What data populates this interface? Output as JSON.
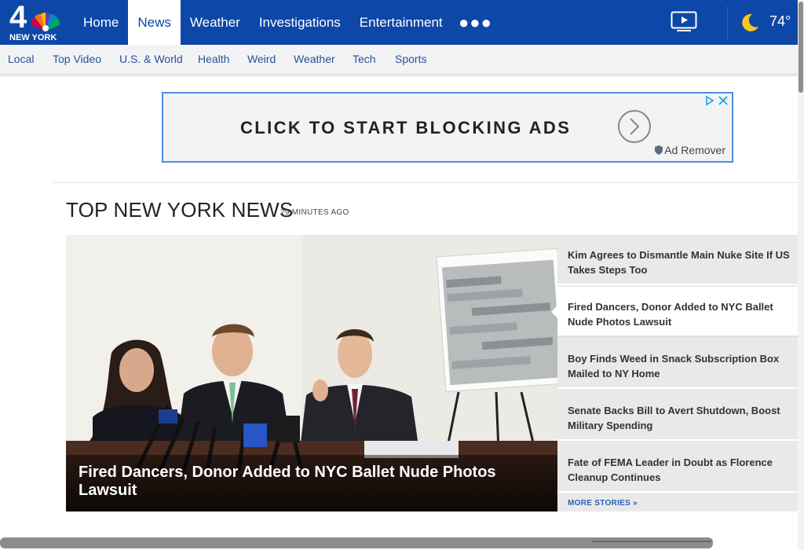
{
  "header": {
    "logo_text": "NEW YORK",
    "logo_number": "4",
    "nav": [
      {
        "label": "Home"
      },
      {
        "label": "News",
        "active": true
      },
      {
        "label": "Weather"
      },
      {
        "label": "Investigations"
      },
      {
        "label": "Entertainment"
      }
    ],
    "more_icon": "more-dots-icon",
    "video_icon": "video-player-icon",
    "weather": {
      "icon": "moon-icon",
      "temperature": "74°"
    }
  },
  "subnav": [
    "Local",
    "Top Video",
    "U.S. & World",
    "Health",
    "Weird",
    "Weather",
    "Tech",
    "Sports"
  ],
  "ad": {
    "headline": "CLICK TO START BLOCKING ADS",
    "brand": "Ad Remover",
    "arrow_icon": "circle-arrow-icon",
    "adchoices_icon": "adchoices-close-icon"
  },
  "section": {
    "title": "TOP NEW YORK NEWS",
    "timestamp": "29 MINUTES AGO"
  },
  "hero": {
    "headline": "Fired Dancers, Donor Added to NYC Ballet Nude Photos Lawsuit"
  },
  "stories": [
    {
      "title": "Kim Agrees to Dismantle Main Nuke Site If US Takes Steps Too"
    },
    {
      "title": "Fired Dancers, Donor Added to NYC Ballet Nude Photos Lawsuit",
      "active": true
    },
    {
      "title": "Boy Finds Weed in Snack Subscription Box Mailed to NY Home"
    },
    {
      "title": "Senate Backs Bill to Avert Shutdown, Boost Military Spending"
    },
    {
      "title": "Fate of FEMA Leader in Doubt as Florence Cleanup Continues"
    }
  ],
  "more_stories": "MORE STORIES »",
  "colors": {
    "brand_blue": "#0d47a8",
    "link_blue": "#2b5fb8",
    "ad_border": "#4a8fe0",
    "moon": "#f6c81c"
  }
}
